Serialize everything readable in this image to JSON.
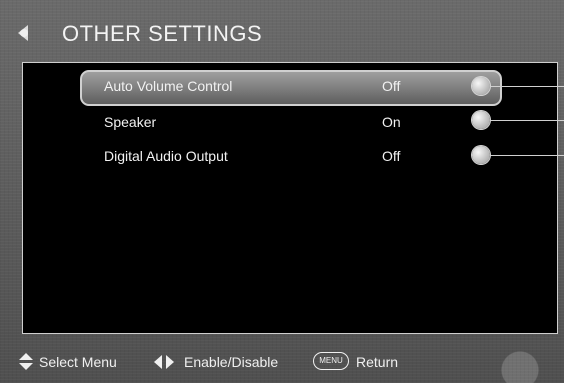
{
  "header": {
    "title": "OTHER SETTINGS"
  },
  "menu": {
    "items": [
      {
        "label": "Auto Volume Control",
        "value": "Off"
      },
      {
        "label": "Speaker",
        "value": "On"
      },
      {
        "label": "Digital Audio Output",
        "value": "Off"
      }
    ]
  },
  "footer": {
    "select_label": "Select Menu",
    "enable_label": "Enable/Disable",
    "menu_icon_text": "MENU",
    "return_label": "Return"
  },
  "icons": {
    "back": "back-icon",
    "updown": "updown-arrows-icon",
    "leftright": "leftright-arrows-icon",
    "menu": "menu-icon",
    "marker": "callout-marker-icon"
  }
}
